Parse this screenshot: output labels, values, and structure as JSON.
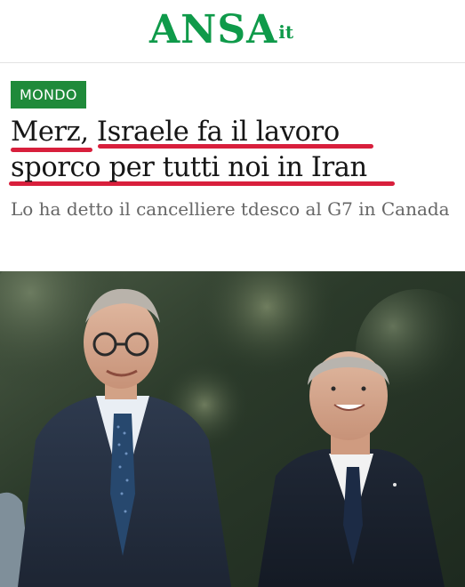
{
  "brand": {
    "name": "ANSA",
    "suffix": "it",
    "color": "#0f9a4a"
  },
  "article": {
    "section": "MONDO",
    "headline_line1": "Merz, Israele fa il lavoro",
    "headline_line2": "sporco per tutti noi in Iran",
    "subtitle": "Lo ha detto il cancelliere tdesco al G7 in Canada"
  },
  "colors": {
    "badge": "#1f8a3a",
    "underline": "#d81f3c"
  }
}
